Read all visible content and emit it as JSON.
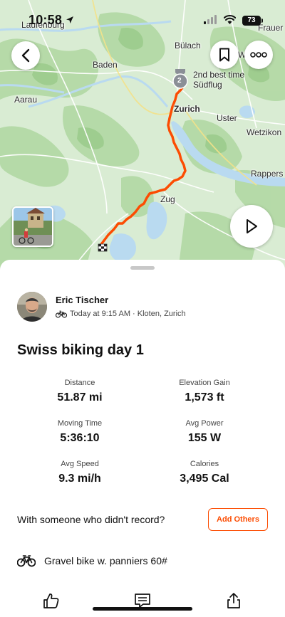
{
  "status_bar": {
    "time": "10:58",
    "battery": "73"
  },
  "map": {
    "labels": {
      "lauffenburg": "Laufenburg",
      "frauen": "Frauer",
      "bulach": "Bülach",
      "w_partial": "W",
      "baden": "Baden",
      "aarau": "Aarau",
      "zurich": "Zurich",
      "uster": "Uster",
      "wetzikon": "Wetzikon",
      "rappers": "Rappers",
      "zug": "Zug"
    },
    "medal": {
      "rank": "2",
      "line1": "2nd best time",
      "line2": "Südflug"
    },
    "route_color": "#fc4c02"
  },
  "buttons": {
    "back_icon": "chevron-left-icon",
    "save_icon": "bookmark-icon",
    "more_icon": "more-options-icon",
    "play_icon": "play-icon"
  },
  "activity": {
    "athlete_name": "Eric Tischer",
    "meta": "Today at 9:15 AM · Kloten, Zurich",
    "title": "Swiss biking day 1",
    "stats": {
      "distance_label": "Distance",
      "distance_value": "51.87 mi",
      "elevation_label": "Elevation Gain",
      "elevation_value": "1,573 ft",
      "moving_time_label": "Moving Time",
      "moving_time_value": "5:36:10",
      "avg_power_label": "Avg Power",
      "avg_power_value": "155 W",
      "avg_speed_label": "Avg Speed",
      "avg_speed_value": "9.3 mi/h",
      "calories_label": "Calories",
      "calories_value": "3,495 Cal"
    },
    "with_someone_prompt": "With someone who didn't record?",
    "add_others_label": "Add Others",
    "gear_name": "Gravel bike w. panniers 60#"
  },
  "action_bar": {
    "like_icon": "thumbs-up-icon",
    "comment_icon": "comment-icon",
    "share_icon": "share-icon"
  },
  "colors": {
    "accent": "#fc4c02",
    "map_green": "#d9ecd3",
    "water": "#b9daf0"
  }
}
